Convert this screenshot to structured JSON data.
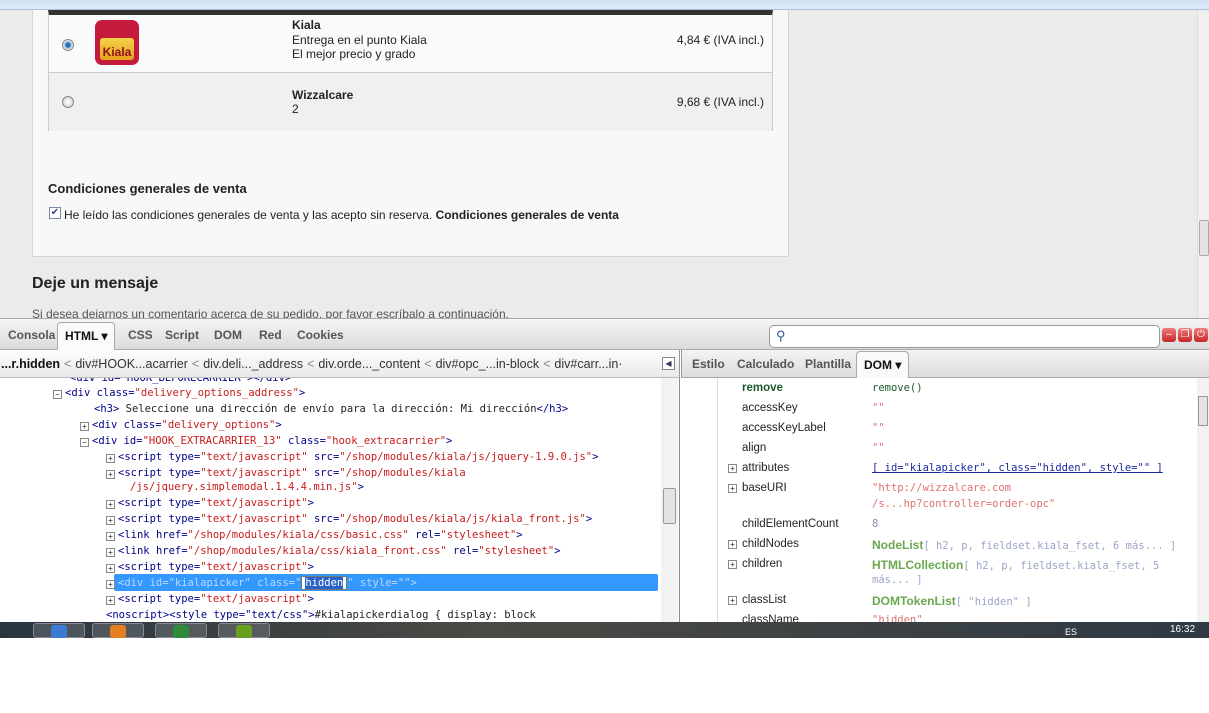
{
  "carriers": [
    {
      "name": "Kiala",
      "lines": [
        "Entrega en el punto Kiala",
        "El mejor precio y grado"
      ],
      "price": "4,84 € (IVA incl.)",
      "selected": true,
      "logo_text": "Kiala"
    },
    {
      "name": "Wizzalcare",
      "lines": [
        "2"
      ],
      "price": "9,68 € (IVA incl.)",
      "selected": false
    }
  ],
  "conditions": {
    "heading": "Condiciones generales de venta",
    "checkbox_text": "He leído las condiciones generales de venta y las acepto sin reserva.",
    "link": "Condiciones generales de venta",
    "checked": true
  },
  "message": {
    "heading": "Deje un mensaje",
    "text": "Si desea dejarnos un comentario acerca de su pedido, por favor escríbalo a continuación."
  },
  "firebug": {
    "tabs": [
      "Consola",
      "HTML ▾",
      "CSS",
      "Script",
      "DOM",
      "Red",
      "Cookies"
    ],
    "search_placeholder": "",
    "breadcrumbs": [
      "...r.hidden",
      "div#HOOK...acarrier",
      "div.deli..._address",
      "div.orde..._content",
      "div#opc_...in-block",
      "div#carr...in·"
    ],
    "side_tabs": [
      "Estilo",
      "Calculado",
      "Plantilla",
      "DOM ▾"
    ],
    "html_lines": [
      {
        "tw": "",
        "seg": [
          [
            "tg",
            "<div id=\"HOOK_BEFORECARRIER\"></div>"
          ]
        ]
      },
      {
        "tw": "−",
        "seg": [
          [
            "tg",
            "<div "
          ],
          [
            "at",
            "class="
          ],
          [
            "vl",
            "\"delivery_options_address\""
          ],
          [
            "tg",
            ">"
          ]
        ]
      },
      {
        "tw": "",
        "seg": [
          [
            "tg",
            "<h3>"
          ],
          [
            "tx",
            " Seleccione una dirección de envío para la dirección: Mi dirección"
          ],
          [
            "tg",
            "</h3>"
          ]
        ]
      },
      {
        "tw": "+",
        "seg": [
          [
            "tg",
            "<div "
          ],
          [
            "at",
            "class="
          ],
          [
            "vl",
            "\"delivery_options\""
          ],
          [
            "tg",
            ">"
          ]
        ]
      },
      {
        "tw": "−",
        "seg": [
          [
            "tg",
            "<div "
          ],
          [
            "at",
            "id="
          ],
          [
            "vl",
            "\"HOOK_EXTRACARRIER_13\""
          ],
          [
            "at",
            " class="
          ],
          [
            "vl",
            "\"hook_extracarrier\""
          ],
          [
            "tg",
            ">"
          ]
        ]
      },
      {
        "tw": "+",
        "seg": [
          [
            "tg",
            "<script "
          ],
          [
            "at",
            "type="
          ],
          [
            "vl",
            "\"text/javascript\""
          ],
          [
            "at",
            " src="
          ],
          [
            "vl",
            "\"/shop/modules/kiala/js/jquery-1.9.0.js\""
          ],
          [
            "tg",
            ">"
          ]
        ]
      },
      {
        "tw": "+",
        "seg": [
          [
            "tg",
            "<script "
          ],
          [
            "at",
            "type="
          ],
          [
            "vl",
            "\"text/javascript\""
          ],
          [
            "at",
            " src="
          ],
          [
            "vl",
            "\"/shop/modules/kiala"
          ]
        ]
      },
      {
        "tw": "",
        "seg": [
          [
            "vl",
            "/js/jquery.simplemodal.1.4.4.min.js\""
          ],
          [
            "tg",
            ">"
          ]
        ]
      },
      {
        "tw": "+",
        "seg": [
          [
            "tg",
            "<script "
          ],
          [
            "at",
            "type="
          ],
          [
            "vl",
            "\"text/javascript\""
          ],
          [
            "tg",
            ">"
          ]
        ]
      },
      {
        "tw": "+",
        "seg": [
          [
            "tg",
            "<script "
          ],
          [
            "at",
            "type="
          ],
          [
            "vl",
            "\"text/javascript\""
          ],
          [
            "at",
            " src="
          ],
          [
            "vl",
            "\"/shop/modules/kiala/js/kiala_front.js\""
          ],
          [
            "tg",
            ">"
          ]
        ]
      },
      {
        "tw": "+",
        "seg": [
          [
            "tg",
            "<link "
          ],
          [
            "at",
            "href="
          ],
          [
            "vl",
            "\"/shop/modules/kiala/css/basic.css\""
          ],
          [
            "at",
            " rel="
          ],
          [
            "vl",
            "\"stylesheet\""
          ],
          [
            "tg",
            ">"
          ]
        ]
      },
      {
        "tw": "+",
        "seg": [
          [
            "tg",
            "<link "
          ],
          [
            "at",
            "href="
          ],
          [
            "vl",
            "\"/shop/modules/kiala/css/kiala_front.css\""
          ],
          [
            "at",
            " rel="
          ],
          [
            "vl",
            "\"stylesheet\""
          ],
          [
            "tg",
            ">"
          ]
        ]
      },
      {
        "tw": "+",
        "seg": [
          [
            "tg",
            "<script "
          ],
          [
            "at",
            "type="
          ],
          [
            "vl",
            "\"text/javascript\""
          ],
          [
            "tg",
            ">"
          ]
        ]
      },
      {
        "tw": "+",
        "seg": [
          [
            "x",
            "<div id=\"kialapicker\" class=\""
          ],
          [
            "edit",
            "hidden"
          ],
          [
            "x",
            "\" style=\"\">"
          ]
        ]
      },
      {
        "tw": "+",
        "seg": [
          [
            "tg",
            "<script "
          ],
          [
            "at",
            "type="
          ],
          [
            "vl",
            "\"text/javascript\""
          ],
          [
            "tg",
            ">"
          ]
        ]
      },
      {
        "tw": "",
        "seg": [
          [
            "tg",
            "<noscript>"
          ],
          [
            "tg",
            "<style type=\"text/css\">"
          ],
          [
            "tx",
            "#kialapickerdialog { display: block"
          ]
        ]
      }
    ],
    "dom_rows": [
      {
        "name": "remove",
        "value": "remove()",
        "kind": "fn",
        "tw": ""
      },
      {
        "name": "accessKey",
        "value": "\"\"",
        "kind": "str",
        "tw": ""
      },
      {
        "name": "accessKeyLabel",
        "value": "\"\"",
        "kind": "str",
        "tw": ""
      },
      {
        "name": "align",
        "value": "\"\"",
        "kind": "str",
        "tw": ""
      },
      {
        "name": "attributes",
        "value": "[ id=\"kialapicker\", class=\"hidden\", style=\"\" ]",
        "kind": "lnk",
        "tw": "+"
      },
      {
        "name": "baseURI",
        "value": "\"http://wizzalcare.com",
        "value2": "/s...hp?controller=order-opc\"",
        "kind": "str",
        "tw": "+"
      },
      {
        "name": "childElementCount",
        "value": "8",
        "kind": "num",
        "tw": ""
      },
      {
        "name": "childNodes",
        "obj": "NodeList",
        "value": "[ h2, p, fieldset.kiala_fset, 6 más... ]",
        "kind": "obj",
        "tw": "+"
      },
      {
        "name": "children",
        "obj": "HTMLCollection",
        "value": "[ h2, p, fieldset.kiala_fset, 5",
        "value2": "más... ]",
        "kind": "obj",
        "tw": "+"
      },
      {
        "name": "classList",
        "obj": "DOMTokenList",
        "value": "[ \"hidden\" ]",
        "kind": "obj",
        "tw": "+"
      },
      {
        "name": "className",
        "value": "\"hidden\"",
        "kind": "str",
        "tw": ""
      }
    ]
  },
  "taskbar": {
    "lang": "ES",
    "clock": "16:32"
  }
}
